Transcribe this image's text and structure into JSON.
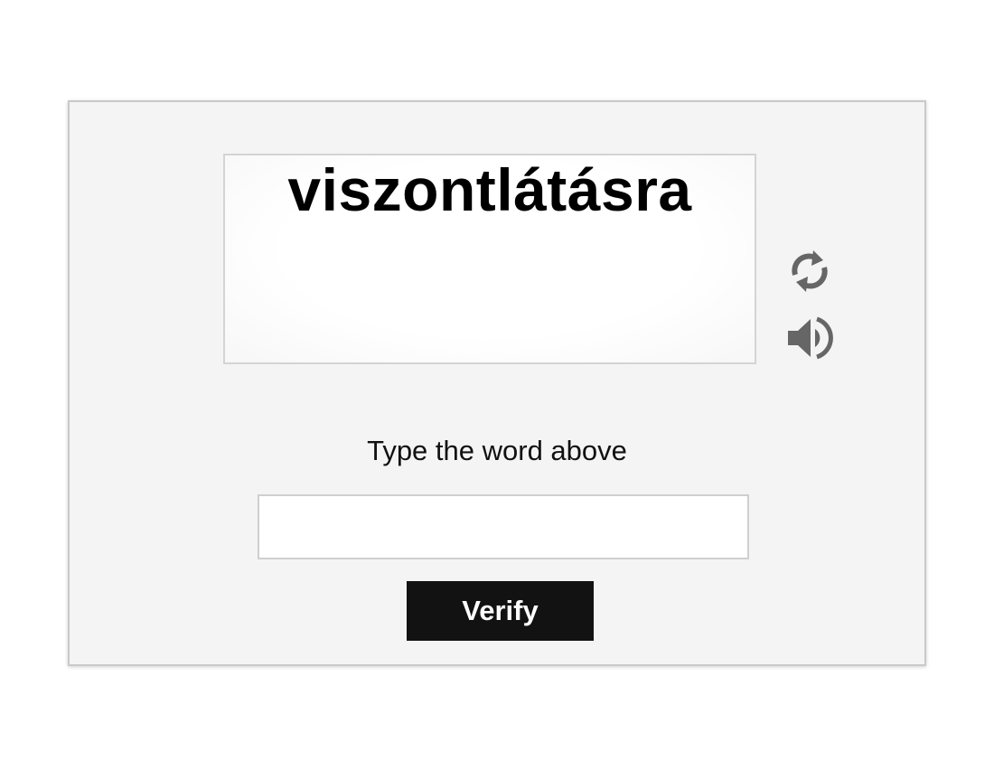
{
  "captcha": {
    "word": "viszontlátásra",
    "refresh_icon": "refresh-icon",
    "audio_icon": "speaker-icon",
    "icon_color": "#666666"
  },
  "prompt": {
    "label": "Type the word above"
  },
  "answer": {
    "value": "",
    "placeholder": ""
  },
  "actions": {
    "verify_label": "Verify",
    "verify_bg": "#121212",
    "verify_text_color": "#ffffff"
  },
  "theme": {
    "panel_bg": "#f4f4f4",
    "panel_border": "#c9c9c9"
  }
}
